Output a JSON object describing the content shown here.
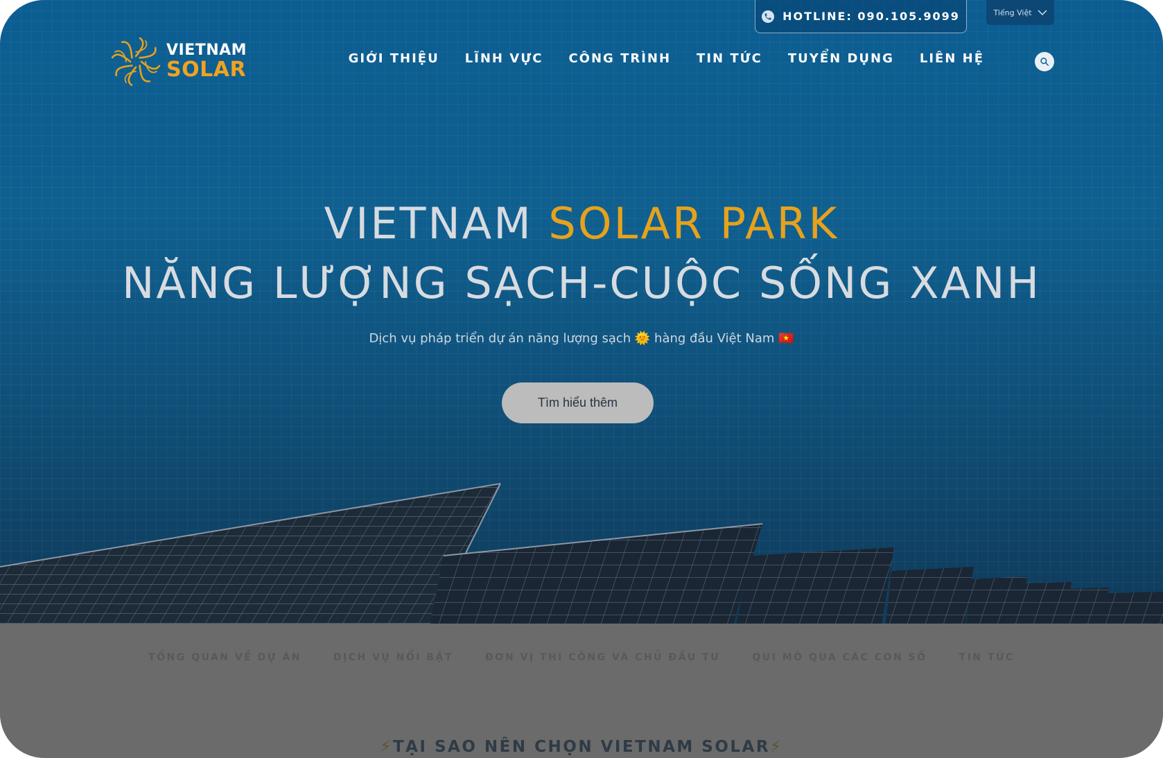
{
  "topbar": {
    "hotline": "HOTLINE: 090.105.9099",
    "language": "Tiếng Việt"
  },
  "logo": {
    "line1": "VIETNAM",
    "line2": "SOLAR"
  },
  "nav": {
    "items": [
      "GIỚI THIỆU",
      "LĨNH VỰC",
      "CÔNG TRÌNH",
      "TIN TỨC",
      "TUYỂN DỤNG",
      "LIÊN HỆ"
    ]
  },
  "hero": {
    "title_part1": "VIETNAM ",
    "title_part2": "SOLAR PARK",
    "title_line2": "NĂNG LƯỢNG SẠCH-CUỘC SỐNG XANH",
    "subtitle": "Dịch vụ pháp triển dự án năng lượng sạch 🌞 hàng đầu Việt Nam 🇻🇳",
    "cta": "Tìm hiểu thêm"
  },
  "anchors": {
    "items": [
      "TỔNG QUAN VỀ DỰ ÁN",
      "DỊCH VỤ NỔI BẬT",
      "ĐƠN VỊ THI CÔNG VÀ CHỦ ĐẦU TƯ",
      "QUI MÔ QUA CÁC CON SỐ",
      "TIN TỨC"
    ]
  },
  "section": {
    "title": "TẠI SAO NÊN CHỌN VIETNAM SOLAR",
    "bolt": "⚡"
  },
  "colors": {
    "accent": "#e6a21d",
    "hero_bg": "#0c5d92",
    "lower_bg": "#6b6b6b"
  }
}
